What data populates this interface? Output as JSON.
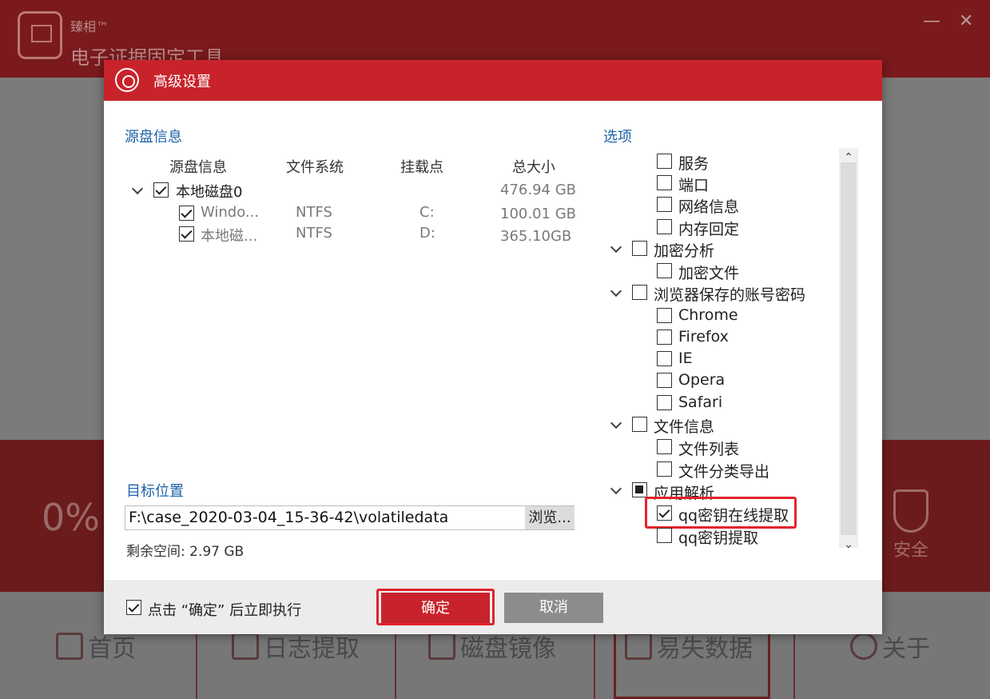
{
  "app": {
    "brand": "臻相™",
    "title": "电子证据固定工具",
    "progress": "0%",
    "safe_label": "安全",
    "nav": [
      {
        "label": "首页"
      },
      {
        "label": "日志提取"
      },
      {
        "label": "磁盘镜像"
      },
      {
        "label": "易失数据"
      },
      {
        "label": "关于"
      }
    ]
  },
  "dialog": {
    "title": "高级设置",
    "source_section_title": "源盘信息",
    "columns": [
      "源盘信息",
      "文件系统",
      "挂载点",
      "总大小"
    ],
    "disk": {
      "name": "本地磁盘0",
      "size": "476.94 GB",
      "checked": true
    },
    "partitions": [
      {
        "name": "Windo...",
        "fs": "NTFS",
        "mount": "C:",
        "size": "100.01 GB",
        "checked": true
      },
      {
        "name": "本地磁...",
        "fs": "NTFS",
        "mount": "D:",
        "size": "365.10GB",
        "checked": true
      }
    ],
    "options_section_title": "选项",
    "options": [
      {
        "label": "服务",
        "state": "unchecked"
      },
      {
        "label": "端口",
        "state": "unchecked"
      },
      {
        "label": "网络信息",
        "state": "unchecked"
      },
      {
        "label": "内存回定",
        "state": "unchecked"
      },
      {
        "label": "加密分析",
        "state": "unchecked"
      },
      {
        "label": "加密文件",
        "state": "unchecked"
      },
      {
        "label": "浏览器保存的账号密码",
        "state": "unchecked"
      },
      {
        "label": "Chrome",
        "state": "unchecked"
      },
      {
        "label": "Firefox",
        "state": "unchecked"
      },
      {
        "label": "IE",
        "state": "unchecked"
      },
      {
        "label": "Opera",
        "state": "unchecked"
      },
      {
        "label": "Safari",
        "state": "unchecked"
      },
      {
        "label": "文件信息",
        "state": "unchecked"
      },
      {
        "label": "文件列表",
        "state": "unchecked"
      },
      {
        "label": "文件分类导出",
        "state": "unchecked"
      },
      {
        "label": "应用解析",
        "state": "partial"
      },
      {
        "label": "qq密钥在线提取",
        "state": "checked"
      },
      {
        "label": "qq密钥提取",
        "state": "unchecked"
      }
    ],
    "target_section_title": "目标位置",
    "target_path": "F:\\case_2020-03-04_15-36-42\\volatiledata",
    "browse_label": "浏览...",
    "free_space": "剩余空间:  2.97 GB",
    "exec_after_ok_label": "点击 “确定” 后立即执行",
    "exec_after_ok_checked": true,
    "ok_label": "确定",
    "cancel_label": "取消"
  }
}
